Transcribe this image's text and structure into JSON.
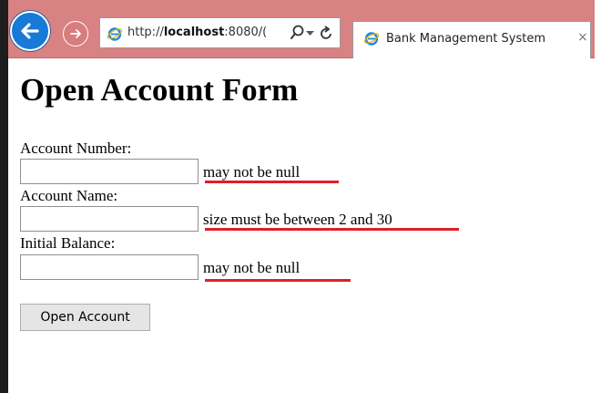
{
  "browser": {
    "url_host": "http://",
    "url_bold": "localhost",
    "url_rest": ":8080/(",
    "tab_title": "Bank Management System",
    "tab_close": "×"
  },
  "page": {
    "title": "Open Account Form"
  },
  "form": {
    "fields": [
      {
        "label": "Account Number:",
        "value": "",
        "error": "may not be null"
      },
      {
        "label": "Account Name:",
        "value": "",
        "error": "size must be between 2 and 30"
      },
      {
        "label": "Initial Balance:",
        "value": "",
        "error": "may not be null"
      }
    ],
    "submit_label": "Open Account"
  },
  "colors": {
    "toolbar": "#d98283",
    "error_underline": "#e01f26",
    "back_button": "#1879d6"
  },
  "icons": [
    "back-arrow-icon",
    "forward-arrow-icon",
    "ie-logo-icon",
    "search-icon",
    "dropdown-icon",
    "refresh-icon",
    "close-icon"
  ]
}
